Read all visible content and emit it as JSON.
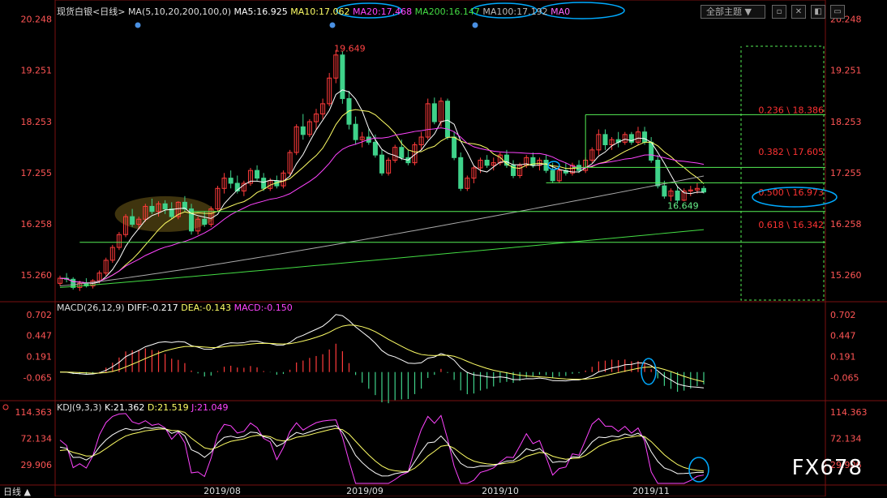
{
  "header": {
    "instrument": "现货白银<日线>",
    "ma_label": "MA(5,10,20,200,100,0)",
    "ma5": "MA5:16.925",
    "ma10": "MA10:17.062",
    "ma20": "MA20:17.468",
    "ma200": "MA200:16.147",
    "ma100": "MA100:17.192",
    "ma0": "MA0",
    "theme_select": "全部主题",
    "tool_1": "▫",
    "tool_2": "✕",
    "tool_3": "◧",
    "tool_4": "▭"
  },
  "price_ticks": [
    "20.248",
    "19.251",
    "18.253",
    "17.255",
    "16.258",
    "15.260"
  ],
  "macd_ticks": [
    "0.702",
    "0.447",
    "0.191",
    "-0.065"
  ],
  "kdj_ticks": [
    "114.363",
    "72.134",
    "29.906"
  ],
  "kdj_right_partial": "29.906",
  "macd_header": {
    "label": "MACD(26,12,9)",
    "diff": "DIFF:-0.217",
    "dea": "DEA:-0.143",
    "macd": "MACD:-0.150"
  },
  "kdj_header": {
    "label": "KDJ(9,3,3)",
    "k": "K:21.362",
    "d": "D:21.519",
    "j": "J:21.049"
  },
  "x_labels": [
    "2019/08",
    "2019/09",
    "2019/10",
    "2019/11"
  ],
  "period_tab": "日线",
  "annotations": {
    "high": "19.649",
    "low": "16.649",
    "fib": [
      "0.236 \\ 18.386",
      "0.382 \\ 17.605",
      "0.500 \\ 16.973",
      "0.618 \\ 16.342"
    ]
  },
  "watermark": "FX678",
  "colors": {
    "up": "#ff3b3b",
    "down": "#3fd28a",
    "ma5": "#ffffff",
    "ma10": "#ffff66",
    "ma20": "#ff44ff",
    "ma100": "#aaaaaa",
    "ma200": "#44dd44",
    "highlight_ring": "#00aaff"
  },
  "chart_data": {
    "type": "candlestick",
    "title": "现货白银<日线>",
    "ylim": [
      14.9,
      20.4
    ],
    "x": [
      "2019/08",
      "2019/09",
      "2019/10",
      "2019/11"
    ],
    "ohlc": [
      [
        15.1,
        15.25,
        15.05,
        15.2
      ],
      [
        15.2,
        15.3,
        15.12,
        15.18
      ],
      [
        15.18,
        15.22,
        14.98,
        15.02
      ],
      [
        15.02,
        15.15,
        14.95,
        15.1
      ],
      [
        15.1,
        15.2,
        15.02,
        15.05
      ],
      [
        15.05,
        15.18,
        15.0,
        15.15
      ],
      [
        15.15,
        15.35,
        15.1,
        15.3
      ],
      [
        15.3,
        15.6,
        15.25,
        15.55
      ],
      [
        15.55,
        15.85,
        15.5,
        15.8
      ],
      [
        15.8,
        16.1,
        15.75,
        16.05
      ],
      [
        16.05,
        16.45,
        16.0,
        16.4
      ],
      [
        16.4,
        16.55,
        16.2,
        16.25
      ],
      [
        16.25,
        16.4,
        16.15,
        16.35
      ],
      [
        16.35,
        16.65,
        16.3,
        16.6
      ],
      [
        16.6,
        16.75,
        16.45,
        16.5
      ],
      [
        16.5,
        16.7,
        16.4,
        16.65
      ],
      [
        16.65,
        16.72,
        16.45,
        16.55
      ],
      [
        16.55,
        16.68,
        16.35,
        16.4
      ],
      [
        16.4,
        16.7,
        16.35,
        16.68
      ],
      [
        16.68,
        16.8,
        16.5,
        16.55
      ],
      [
        16.55,
        16.65,
        16.05,
        16.12
      ],
      [
        16.12,
        16.4,
        16.05,
        16.35
      ],
      [
        16.35,
        16.5,
        16.2,
        16.25
      ],
      [
        16.25,
        16.6,
        16.2,
        16.55
      ],
      [
        16.55,
        17.0,
        16.5,
        16.95
      ],
      [
        16.95,
        17.25,
        16.85,
        17.15
      ],
      [
        17.15,
        17.3,
        16.95,
        17.05
      ],
      [
        17.05,
        17.2,
        16.85,
        16.9
      ],
      [
        16.9,
        17.1,
        16.8,
        17.05
      ],
      [
        17.05,
        17.35,
        17.0,
        17.3
      ],
      [
        17.3,
        17.4,
        17.1,
        17.15
      ],
      [
        17.15,
        17.25,
        16.9,
        16.95
      ],
      [
        16.95,
        17.15,
        16.9,
        17.1
      ],
      [
        17.1,
        17.2,
        16.95,
        17.0
      ],
      [
        17.0,
        17.3,
        16.95,
        17.25
      ],
      [
        17.25,
        17.7,
        17.2,
        17.65
      ],
      [
        17.65,
        18.2,
        17.6,
        18.15
      ],
      [
        18.15,
        18.4,
        17.9,
        18.0
      ],
      [
        18.0,
        18.3,
        17.95,
        18.25
      ],
      [
        18.25,
        18.5,
        18.1,
        18.4
      ],
      [
        18.4,
        18.7,
        18.3,
        18.6
      ],
      [
        18.6,
        19.2,
        18.55,
        19.1
      ],
      [
        19.1,
        19.65,
        19.0,
        19.55
      ],
      [
        19.55,
        19.62,
        18.6,
        18.7
      ],
      [
        18.7,
        18.85,
        18.1,
        18.2
      ],
      [
        18.2,
        18.35,
        17.8,
        17.9
      ],
      [
        17.9,
        18.05,
        17.75,
        17.95
      ],
      [
        17.95,
        18.1,
        17.8,
        17.85
      ],
      [
        17.85,
        18.0,
        17.55,
        17.6
      ],
      [
        17.6,
        17.7,
        17.2,
        17.25
      ],
      [
        17.25,
        17.55,
        17.2,
        17.5
      ],
      [
        17.5,
        17.8,
        17.45,
        17.75
      ],
      [
        17.75,
        17.9,
        17.5,
        17.55
      ],
      [
        17.55,
        17.7,
        17.4,
        17.45
      ],
      [
        17.45,
        17.85,
        17.4,
        17.8
      ],
      [
        17.8,
        18.05,
        17.7,
        17.95
      ],
      [
        17.95,
        18.7,
        17.9,
        18.6
      ],
      [
        18.6,
        18.72,
        18.2,
        18.25
      ],
      [
        18.25,
        18.72,
        18.15,
        18.65
      ],
      [
        18.65,
        18.7,
        17.9,
        17.95
      ],
      [
        17.95,
        18.05,
        17.5,
        17.55
      ],
      [
        17.55,
        17.65,
        16.9,
        16.95
      ],
      [
        16.95,
        17.2,
        16.9,
        17.15
      ],
      [
        17.15,
        17.4,
        17.05,
        17.35
      ],
      [
        17.35,
        17.55,
        17.25,
        17.5
      ],
      [
        17.5,
        17.6,
        17.35,
        17.4
      ],
      [
        17.4,
        17.55,
        17.3,
        17.45
      ],
      [
        17.45,
        17.65,
        17.4,
        17.6
      ],
      [
        17.6,
        17.7,
        17.35,
        17.4
      ],
      [
        17.4,
        17.5,
        17.15,
        17.2
      ],
      [
        17.2,
        17.45,
        17.15,
        17.4
      ],
      [
        17.4,
        17.6,
        17.35,
        17.55
      ],
      [
        17.55,
        17.65,
        17.35,
        17.4
      ],
      [
        17.4,
        17.55,
        17.3,
        17.5
      ],
      [
        17.5,
        17.6,
        17.25,
        17.3
      ],
      [
        17.3,
        17.45,
        17.05,
        17.1
      ],
      [
        17.1,
        17.35,
        17.05,
        17.3
      ],
      [
        17.3,
        17.45,
        17.2,
        17.25
      ],
      [
        17.25,
        17.45,
        17.2,
        17.4
      ],
      [
        17.4,
        17.5,
        17.25,
        17.3
      ],
      [
        17.3,
        17.55,
        17.25,
        17.5
      ],
      [
        17.5,
        17.75,
        17.45,
        17.7
      ],
      [
        17.7,
        18.1,
        17.6,
        18.0
      ],
      [
        18.0,
        18.1,
        17.7,
        17.8
      ],
      [
        17.8,
        17.95,
        17.7,
        17.9
      ],
      [
        17.9,
        18.05,
        17.75,
        17.85
      ],
      [
        17.85,
        18.05,
        17.8,
        18.0
      ],
      [
        18.0,
        18.05,
        17.8,
        17.85
      ],
      [
        17.85,
        18.15,
        17.8,
        18.05
      ],
      [
        18.05,
        18.15,
        17.8,
        17.85
      ],
      [
        17.85,
        17.95,
        17.45,
        17.5
      ],
      [
        17.5,
        17.6,
        16.95,
        17.0
      ],
      [
        17.0,
        17.1,
        16.75,
        16.8
      ],
      [
        16.8,
        16.95,
        16.7,
        16.9
      ],
      [
        16.9,
        16.98,
        16.65,
        16.72
      ],
      [
        16.72,
        16.95,
        16.7,
        16.9
      ],
      [
        16.9,
        17.0,
        16.8,
        16.92
      ],
      [
        16.92,
        17.05,
        16.85,
        16.95
      ],
      [
        16.95,
        17.0,
        16.85,
        16.88
      ]
    ],
    "moving_averages": {
      "MA5": 16.925,
      "MA10": 17.062,
      "MA20": 17.468,
      "MA200": 16.147,
      "MA100": 17.192
    },
    "annotated_high": 19.649,
    "annotated_low": 16.649,
    "fibonacci_levels": [
      {
        "ratio": 0.236,
        "value": 18.386
      },
      {
        "ratio": 0.382,
        "value": 17.605
      },
      {
        "ratio": 0.5,
        "value": 16.973
      },
      {
        "ratio": 0.618,
        "value": 16.342
      }
    ],
    "macd": {
      "ylim": [
        -0.33,
        0.8
      ],
      "DIFF": -0.217,
      "DEA": -0.143,
      "MACD": -0.15
    },
    "kdj": {
      "ylim": [
        0,
        125
      ],
      "K": 21.362,
      "D": 21.519,
      "J": 21.049
    }
  }
}
